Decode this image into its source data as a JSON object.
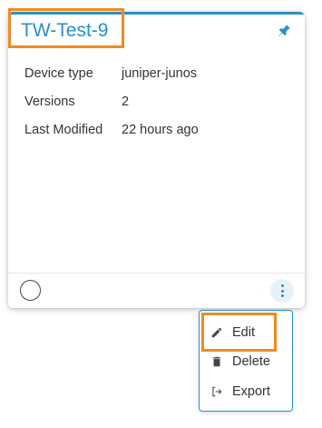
{
  "card": {
    "title": "TW-Test-9",
    "pin_icon": "pin-icon",
    "details": [
      {
        "label": "Device type",
        "value": "juniper-junos"
      },
      {
        "label": "Versions",
        "value": "2"
      },
      {
        "label": "Last Modified",
        "value": "22 hours ago"
      }
    ],
    "accent_color": "#2a8fc6"
  },
  "menu": {
    "items": [
      {
        "label": "Edit",
        "icon": "pencil-icon"
      },
      {
        "label": "Delete",
        "icon": "trash-icon"
      },
      {
        "label": "Export",
        "icon": "export-icon"
      }
    ]
  },
  "highlight_color": "#f18a20"
}
